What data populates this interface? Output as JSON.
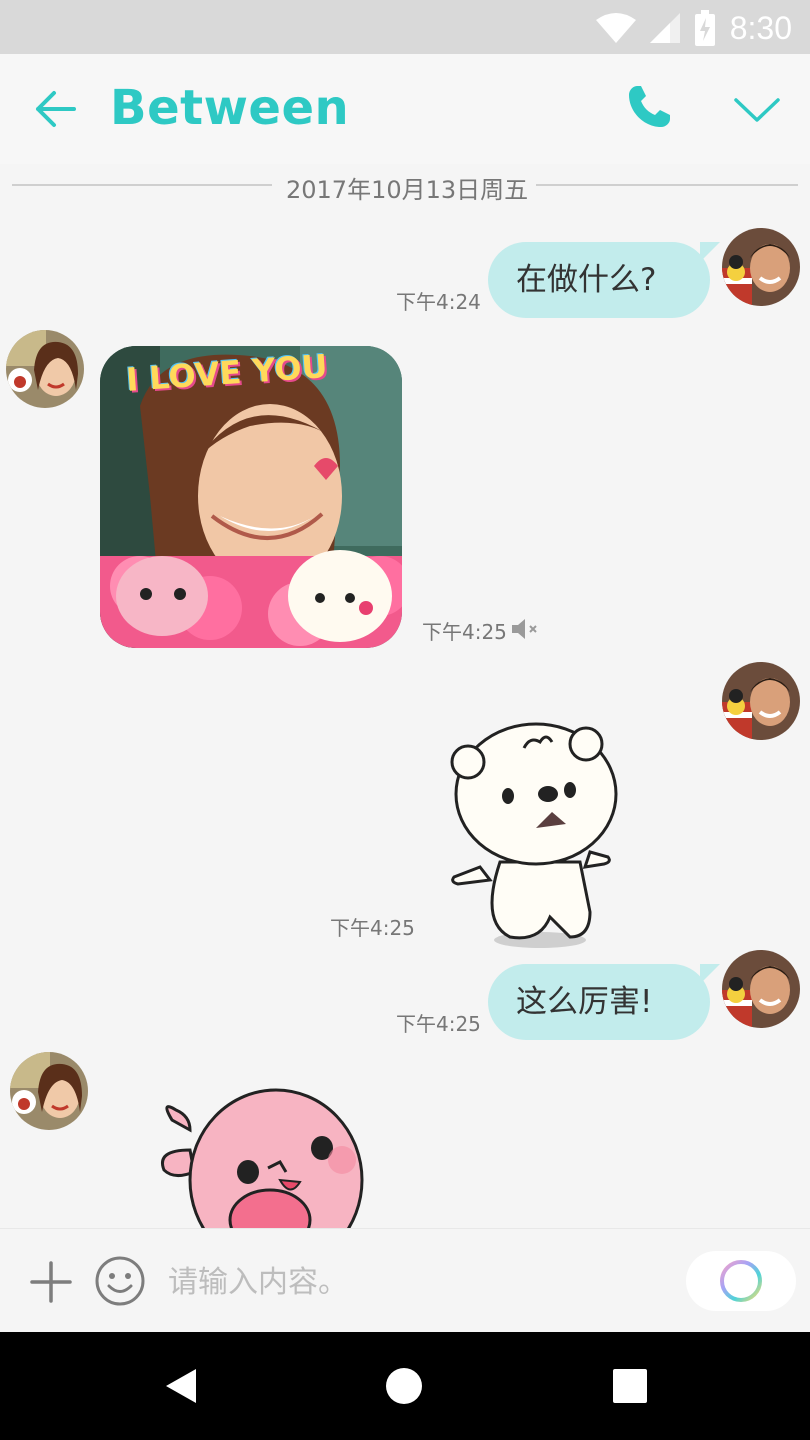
{
  "status_bar": {
    "time": "8:30",
    "icons": [
      "wifi-icon",
      "cell-signal-icon",
      "battery-charging-icon"
    ]
  },
  "header": {
    "title": "Between",
    "back_icon": "arrow-left-icon",
    "call_icon": "phone-icon",
    "menu_icon": "chevron-down-icon",
    "accent_color": "#2ec9c4"
  },
  "chat": {
    "date_separator": "2017年10月13日周五",
    "messages": [
      {
        "sender": "me",
        "type": "text",
        "text": "在做什么?",
        "time": "下午4:24"
      },
      {
        "sender": "partner",
        "type": "photo",
        "overlay_text": "I LOVE YOU",
        "time": "下午4:25",
        "status_icon": "muted-speaker-icon"
      },
      {
        "sender": "me",
        "type": "sticker",
        "sticker": "white-bear-sticker",
        "time": "下午4:25"
      },
      {
        "sender": "me",
        "type": "text",
        "text": "这么厉害!",
        "time": "下午4:25"
      },
      {
        "sender": "partner",
        "type": "sticker",
        "sticker": "pink-seal-sticker"
      }
    ],
    "bubble_color": "#c2ecec"
  },
  "composer": {
    "placeholder": "请输入内容。",
    "plus_icon": "plus-icon",
    "emoji_icon": "smiley-icon",
    "send_icon": "color-ring-icon"
  },
  "nav_bar": {
    "icons": [
      "back-triangle-icon",
      "home-circle-icon",
      "recents-square-icon"
    ]
  }
}
